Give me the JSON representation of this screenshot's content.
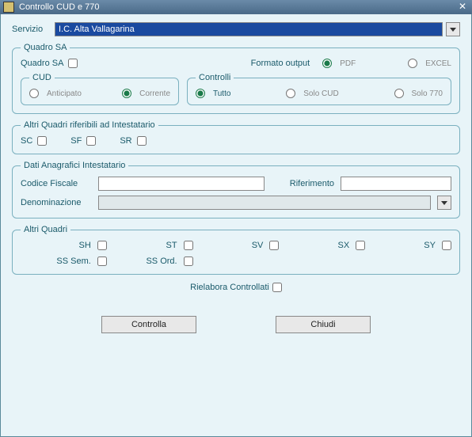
{
  "window": {
    "title": "Controllo CUD e 770"
  },
  "servizio": {
    "label": "Servizio",
    "value": "I.C. Alta Vallagarina"
  },
  "quadroSA": {
    "legend": "Quadro SA",
    "checkbox_label": "Quadro SA",
    "formato_label": "Formato output",
    "formato_pdf": "PDF",
    "formato_excel": "EXCEL",
    "cud": {
      "legend": "CUD",
      "anticipato": "Anticipato",
      "corrente": "Corrente"
    },
    "controlli": {
      "legend": "Controlli",
      "tutto": "Tutto",
      "solo_cud": "Solo CUD",
      "solo_770": "Solo 770"
    }
  },
  "altriIntest": {
    "legend": "Altri Quadri riferibili ad Intestatario",
    "sc": "SC",
    "sf": "SF",
    "sr": "SR"
  },
  "anagrafici": {
    "legend": "Dati Anagrafici Intestatario",
    "cf_label": "Codice Fiscale",
    "rif_label": "Riferimento",
    "den_label": "Denominazione",
    "cf_value": "",
    "rif_value": "",
    "den_value": ""
  },
  "altriQuadri": {
    "legend": "Altri Quadri",
    "sh": "SH",
    "st": "ST",
    "sv": "SV",
    "sx": "SX",
    "sy": "SY",
    "ss_sem": "SS Sem.",
    "ss_ord": "SS Ord."
  },
  "rielabora": "Rielabora Controllati",
  "buttons": {
    "controlla": "Controlla",
    "chiudi": "Chiudi"
  }
}
